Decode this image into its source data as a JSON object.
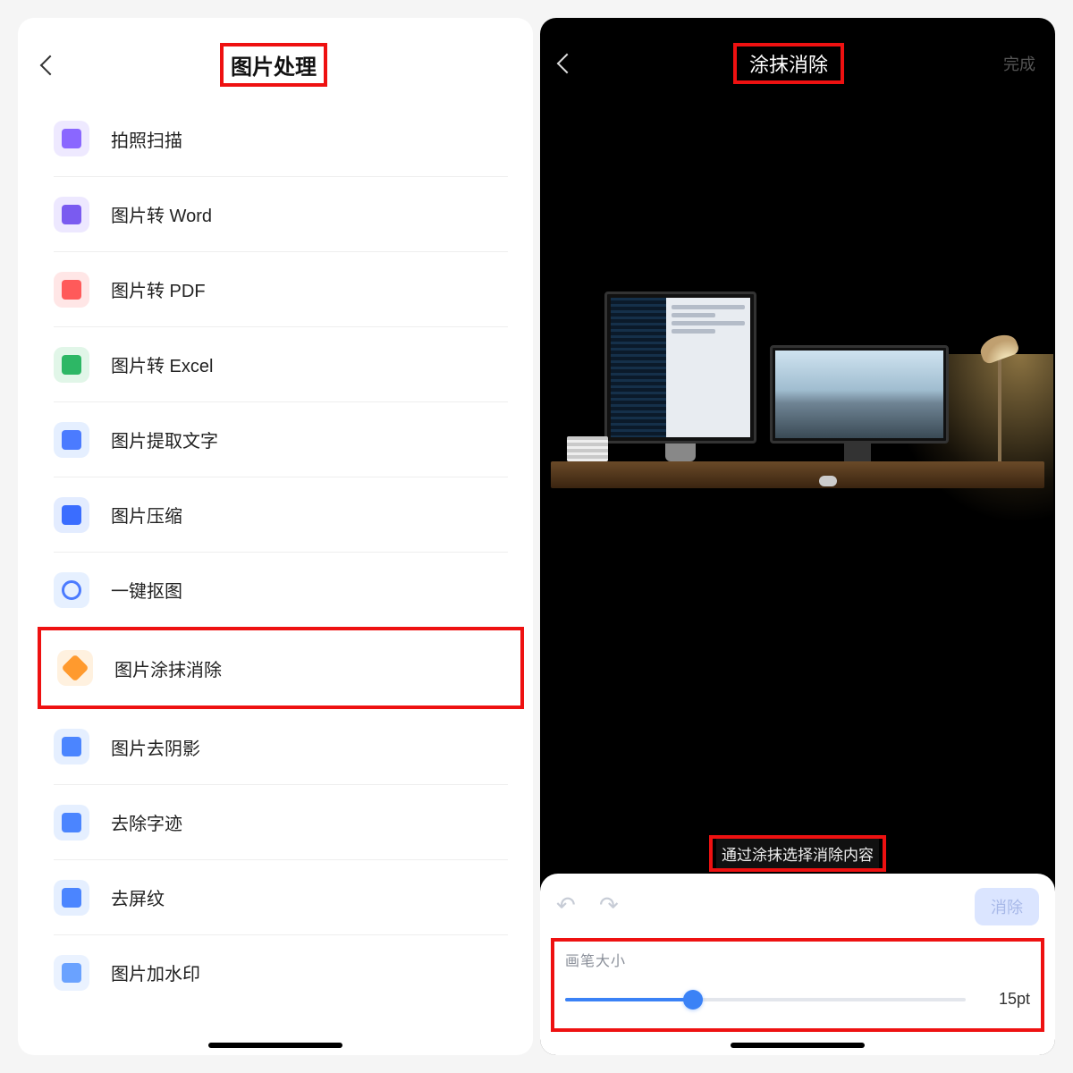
{
  "left": {
    "title": "图片处理",
    "items": [
      {
        "label": "拍照扫描",
        "iconClass": "ic-purple",
        "name": "scan"
      },
      {
        "label": "图片转 Word",
        "iconClass": "ic-purple2",
        "name": "to-word"
      },
      {
        "label": "图片转 PDF",
        "iconClass": "ic-red",
        "name": "to-pdf"
      },
      {
        "label": "图片转 Excel",
        "iconClass": "ic-green",
        "name": "to-excel"
      },
      {
        "label": "图片提取文字",
        "iconClass": "ic-lblue",
        "name": "ocr"
      },
      {
        "label": "图片压缩",
        "iconClass": "ic-blue",
        "name": "compress"
      },
      {
        "label": "一键抠图",
        "iconClass": "ic-blue2",
        "name": "cutout"
      },
      {
        "label": "图片涂抹消除",
        "iconClass": "ic-orange",
        "name": "erase",
        "highlight": true
      },
      {
        "label": "图片去阴影",
        "iconClass": "ic-blue3",
        "name": "deshadow"
      },
      {
        "label": "去除字迹",
        "iconClass": "ic-blue4",
        "name": "remove-hand"
      },
      {
        "label": "去屏纹",
        "iconClass": "ic-blue5",
        "name": "descreen"
      },
      {
        "label": "图片加水印",
        "iconClass": "ic-lblue2",
        "name": "watermark"
      }
    ]
  },
  "right": {
    "title": "涂抹消除",
    "done": "完成",
    "hint": "通过涂抹选择消除内容",
    "erase_btn": "消除",
    "brush_label": "画笔大小",
    "brush_value": "15pt",
    "brush_percent": 32
  }
}
